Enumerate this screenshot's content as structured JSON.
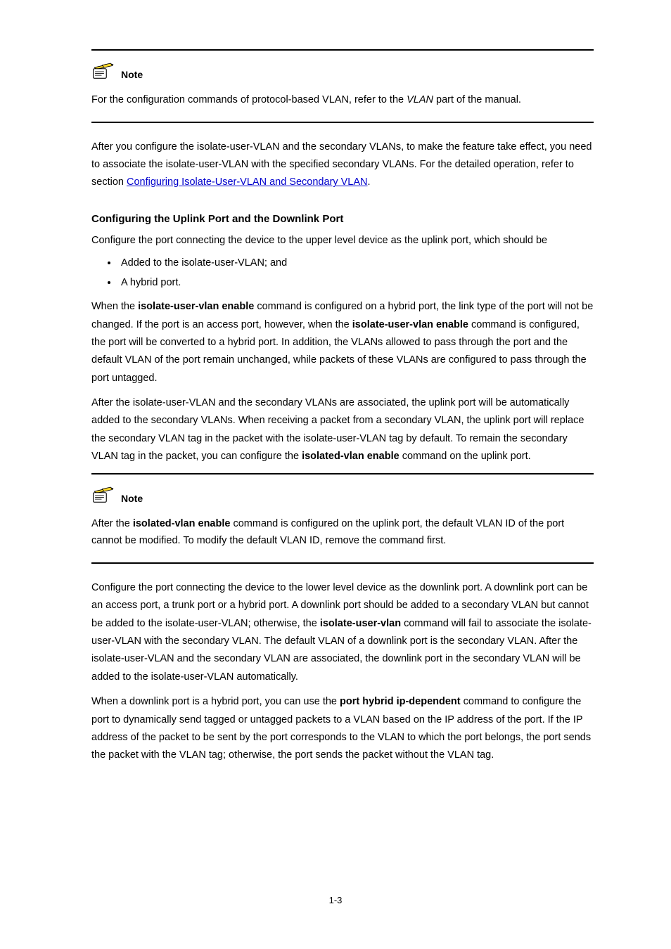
{
  "note1": {
    "label": "Note",
    "body_prefix": "For the configuration commands of protocol-based VLAN, refer to the ",
    "body_italic": "VLAN",
    "body_suffix": " part of the manual."
  },
  "intro": {
    "p1_prefix": "After you configure the isolate-user-VLAN and the secondary VLANs, to make the feature take effect, you need to associate the isolate-user-VLAN with the specified secondary VLANs. For the detailed operation, refer to section ",
    "p1_link": "Configuring Isolate-User-VLAN and Secondary VLAN",
    "p1_suffix": "."
  },
  "section_title": "Configuring the Uplink Port and the Downlink Port",
  "uplink": {
    "p1": "Configure the port connecting the device to the upper level device as the uplink port, which should be",
    "bullets": [
      "Added to the isolate-user-VLAN; and",
      "A hybrid port."
    ],
    "p2_1": "When the ",
    "p2_kw1": "isolate-user-vlan enable",
    "p2_2": " command is configured on a hybrid port, the link type of the port will not be changed. If the port is an access port, however, when the ",
    "p2_kw2": "isolate-user-vlan enable",
    "p2_3": " command is configured, the port will be converted to a hybrid port. In addition, the VLANs allowed to pass through the port and the default VLAN of the port remain unchanged, while packets of these VLANs are configured to pass through the port untagged.",
    "p3_1": "After the isolate-user-VLAN and the secondary VLANs are associated, the uplink port will be automatically added to the secondary VLANs. When receiving a packet from a secondary VLAN, the uplink port will replace the secondary VLAN tag in the packet with the isolate-user-VLAN tag by default. To remain the secondary VLAN tag in the packet, you can configure the ",
    "p3_kw1": "isolated-vlan enable",
    "p3_2": " command on the uplink port."
  },
  "note2": {
    "label": "Note",
    "body_1": "After the ",
    "body_kw": "isolated-vlan enable",
    "body_2": " command is configured on the uplink port, the default VLAN ID of the port cannot be modified. To modify the default VLAN ID, remove the command first."
  },
  "downlink": {
    "p1_1": "Configure the port connecting the device to the lower level device as the downlink port. A downlink port can be an access port, a trunk port or a hybrid port. A downlink port should be added to a secondary VLAN but cannot be added to the isolate-user-VLAN; otherwise, the ",
    "p1_kw1": "isolate-user-vlan",
    "p1_2": " command will fail to associate the isolate-user-VLAN with the secondary VLAN. The default VLAN of a downlink port is the secondary VLAN. After the isolate-user-VLAN and the secondary VLAN are associated, the downlink port in the secondary VLAN will be added to the isolate-user-VLAN automatically.",
    "p2_1": "When a downlink port is a hybrid port, you can use the ",
    "p2_kw1": "port hybrid ip-dependent",
    "p2_2": " command to configure the port to dynamically send tagged or untagged packets to a VLAN based on the IP address of the port. If the IP address of the packet to be sent by the port corresponds to the VLAN to which the port belongs, the port sends the packet with the VLAN tag; otherwise, the port sends the packet without the VLAN tag."
  },
  "pagenum": "1-3"
}
